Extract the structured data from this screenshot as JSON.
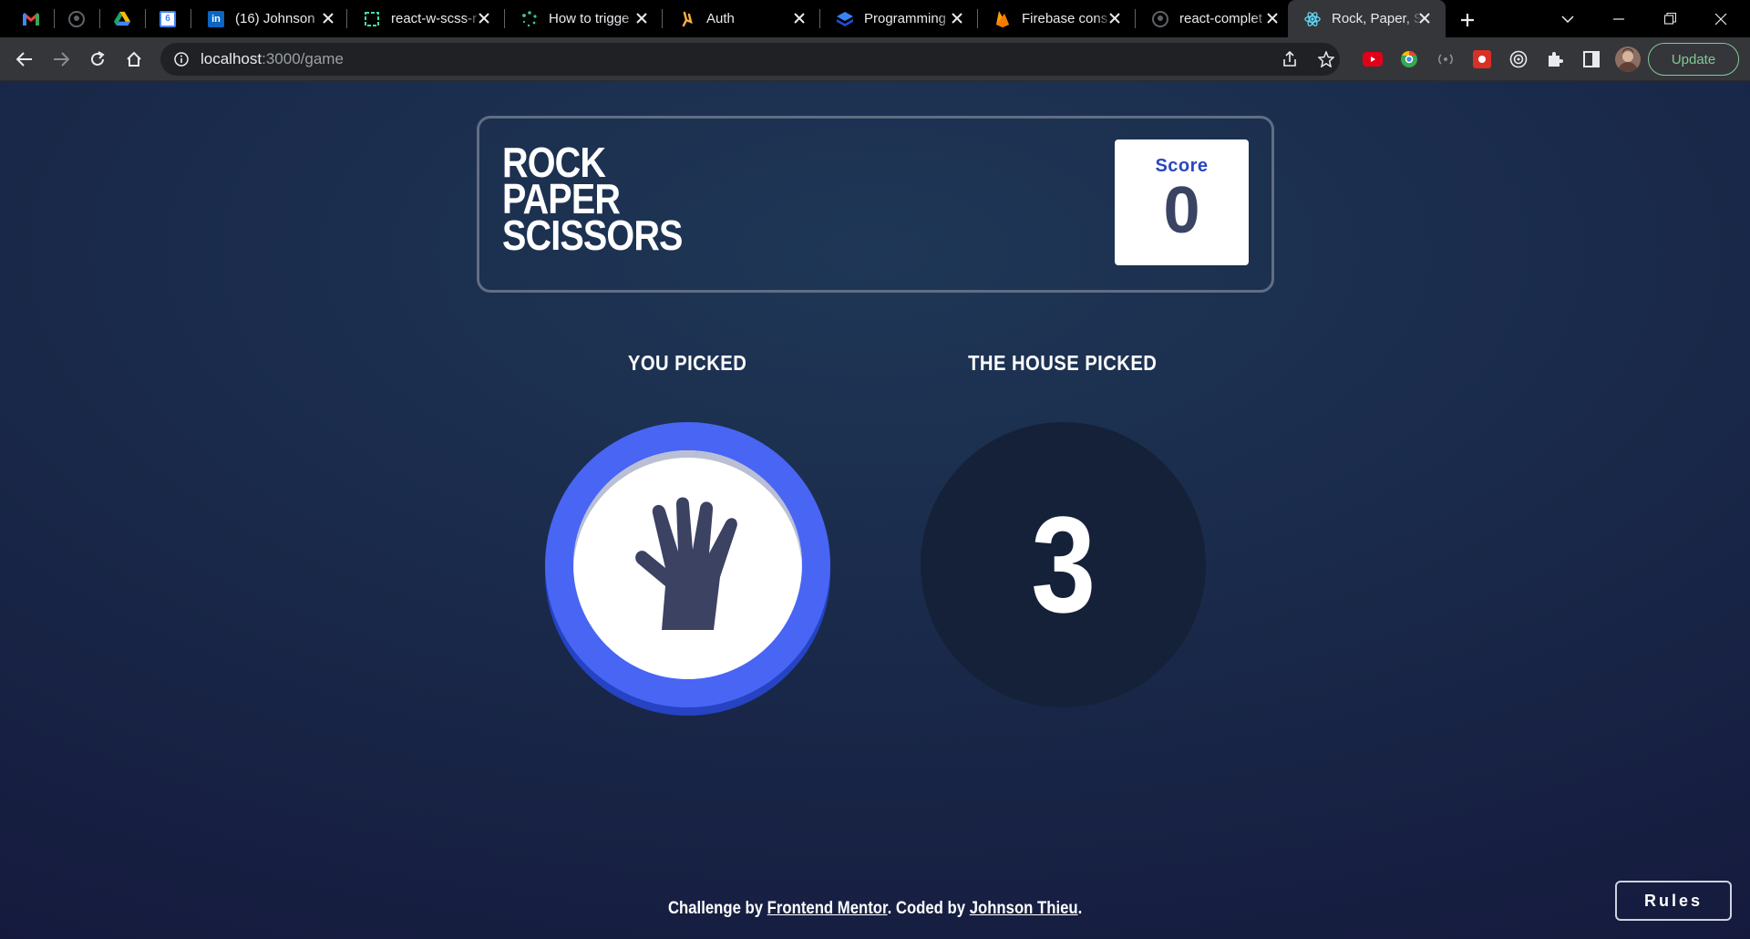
{
  "browser": {
    "tabs": [
      {
        "kind": "pinned",
        "icon": "gmail-icon",
        "title": ""
      },
      {
        "kind": "pinned",
        "icon": "github-icon",
        "title": ""
      },
      {
        "kind": "pinned",
        "icon": "google-drive-icon",
        "title": ""
      },
      {
        "kind": "pinned",
        "icon": "google-calendar-icon",
        "title": "6"
      },
      {
        "kind": "normal",
        "icon": "linkedin-icon",
        "title": "(16) Johnson"
      },
      {
        "kind": "normal",
        "icon": "codesandbox-icon",
        "title": "react-w-scss-r"
      },
      {
        "kind": "normal",
        "icon": "loading-icon",
        "title": "How to trigge"
      },
      {
        "kind": "normal",
        "icon": "auth-app-icon",
        "title": "Auth"
      },
      {
        "kind": "normal",
        "icon": "stackblitz-icon",
        "title": "Programming"
      },
      {
        "kind": "normal",
        "icon": "firebase-icon",
        "title": "Firebase cons"
      },
      {
        "kind": "normal",
        "icon": "github-icon",
        "title": "react-complet"
      },
      {
        "kind": "active",
        "icon": "react-icon",
        "title": "Rock, Paper, S"
      }
    ],
    "url_host": "localhost",
    "url_path": ":3000/game",
    "update_label": "Update"
  },
  "game": {
    "title_lines": [
      "ROCK",
      "PAPER",
      "SCISSORS"
    ],
    "score_label": "Score",
    "score_value": "0",
    "you_picked_label": "YOU PICKED",
    "house_picked_label": "THE HOUSE PICKED",
    "player_choice": "paper",
    "countdown": "3",
    "rules_label": "Rules"
  },
  "footer": {
    "prefix": "Challenge by ",
    "link1": "Frontend Mentor",
    "middle": ". Coded by ",
    "link2": "Johnson Thieu",
    "suffix": "."
  },
  "colors": {
    "paper_blue": "#4865f4",
    "score_blue": "#2a46c0",
    "dark_text": "#3b4363",
    "header_outline": "#606e85",
    "update_green": "#81c995"
  }
}
